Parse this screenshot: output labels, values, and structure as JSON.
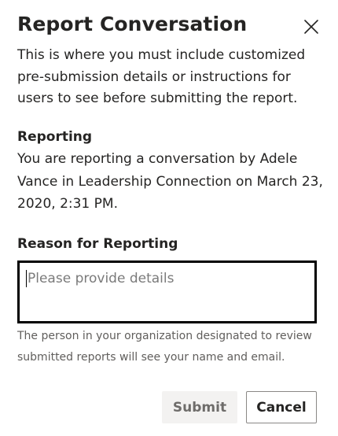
{
  "dialog": {
    "title": "Report Conversation",
    "close_icon": "close-icon",
    "intro": "This is where you must include customized pre-submission details or instructions for users to see before submitting the report.",
    "reporting": {
      "heading": "Reporting",
      "text": "You are reporting a conversation by Adele Vance in Leadership Connection on March 23, 2020, 2:31 PM."
    },
    "reason": {
      "label": "Reason for Reporting",
      "value": "",
      "placeholder": "Please provide details"
    },
    "notice": "The person in your organization designated to review submitted reports will see your name and email.",
    "buttons": {
      "submit": "Submit",
      "cancel": "Cancel"
    }
  },
  "colors": {
    "text": "#252423",
    "secondary_text": "#605e5c",
    "disabled_button_bg": "#f3f2f1",
    "disabled_button_text": "#6e6c6a",
    "field_border": "#000000"
  }
}
